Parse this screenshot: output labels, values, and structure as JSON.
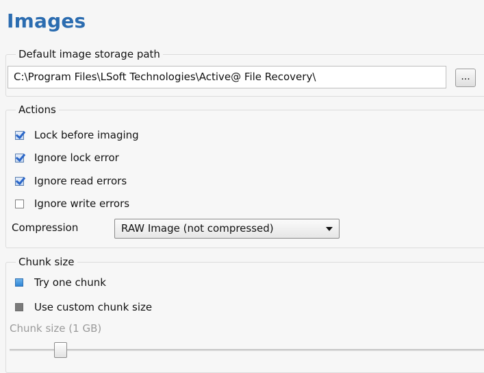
{
  "page": {
    "title": "Images"
  },
  "storage": {
    "group_title": "Default image storage path",
    "path_value": "C:\\Program Files\\LSoft Technologies\\Active@ File Recovery\\",
    "browse_label": "..."
  },
  "actions": {
    "group_title": "Actions",
    "options": [
      {
        "label": "Lock before imaging",
        "checked": true
      },
      {
        "label": "Ignore lock error",
        "checked": true
      },
      {
        "label": "Ignore read errors",
        "checked": true
      },
      {
        "label": "Ignore write errors",
        "checked": false
      }
    ],
    "compression_label": "Compression",
    "compression_value": "RAW Image (not compressed)"
  },
  "chunk": {
    "group_title": "Chunk size",
    "options": [
      {
        "label": "Try one chunk",
        "selected": true
      },
      {
        "label": "Use custom chunk size",
        "selected": false
      }
    ],
    "size_label": "Chunk size (1 GB)",
    "slider_enabled": false
  }
}
